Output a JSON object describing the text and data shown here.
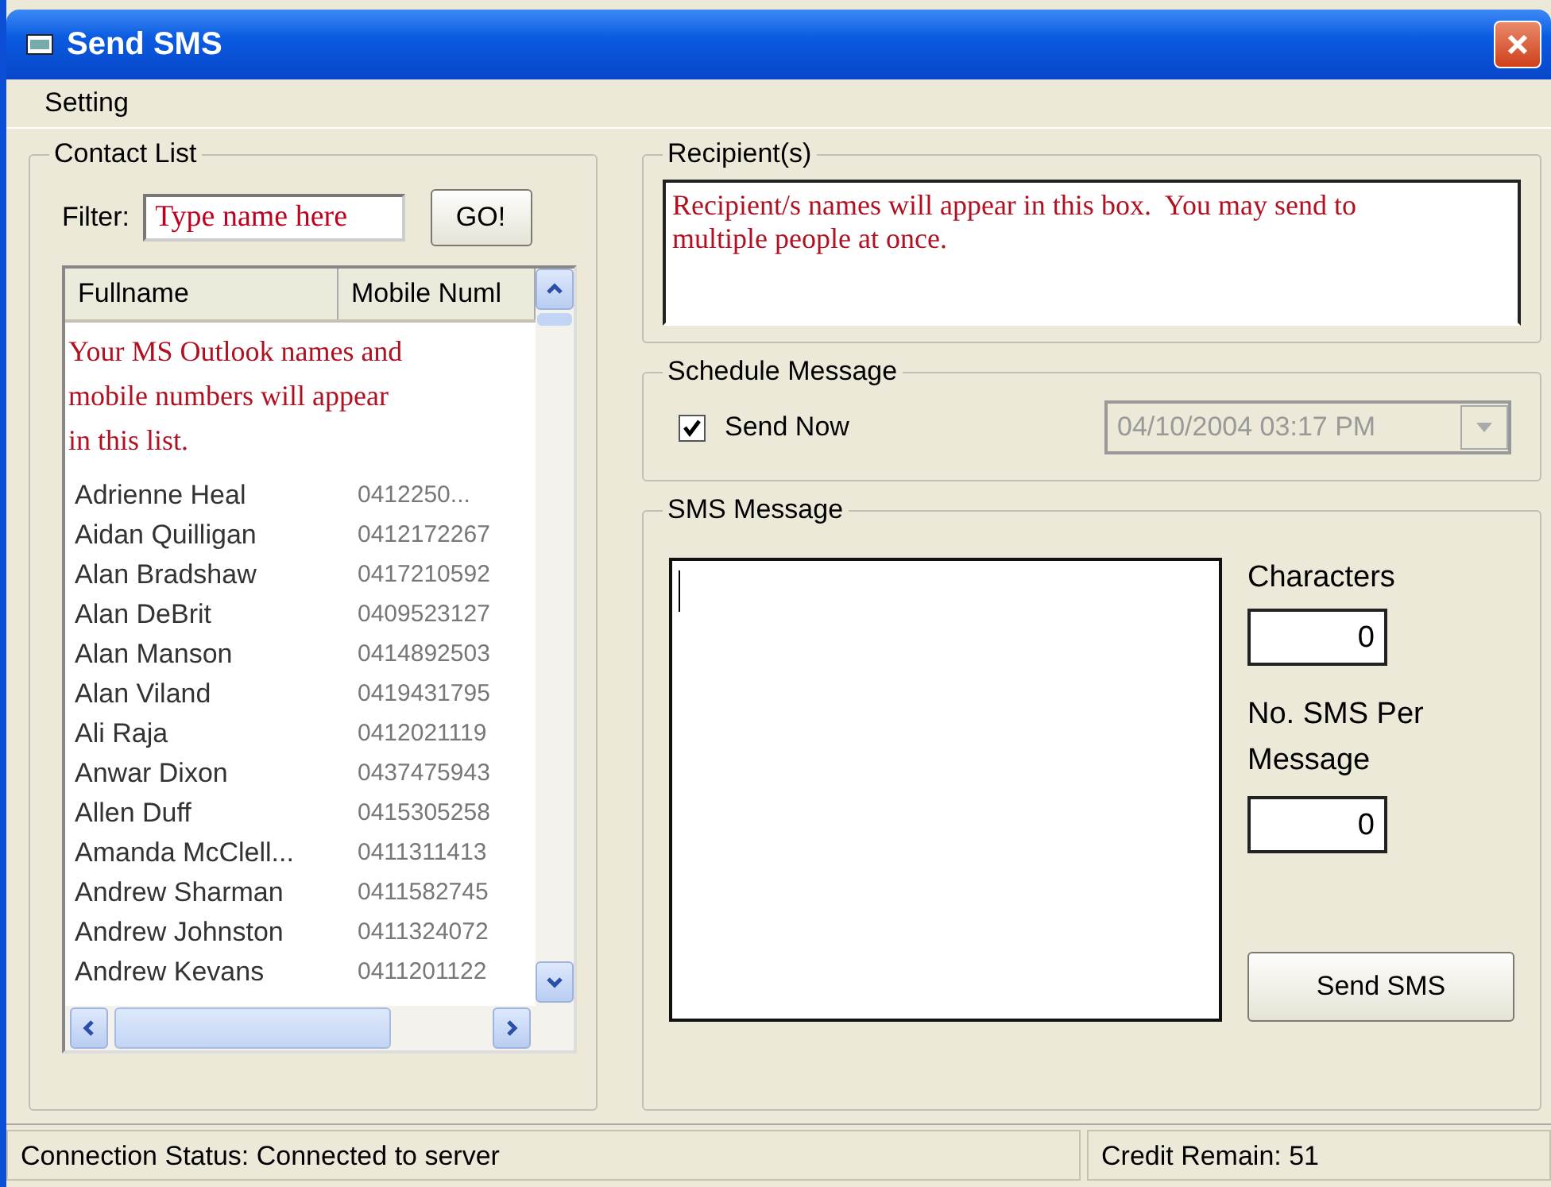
{
  "window": {
    "title": "Send SMS"
  },
  "menu": [
    "Setting"
  ],
  "contact_list": {
    "title": "Contact List",
    "filter_label": "Filter:",
    "filter_placeholder": "Type name here",
    "go_button": "GO!",
    "columns": [
      "Fullname",
      "Mobile Numl"
    ],
    "overlay_text": "Your MS Outlook names and mobile numbers will appear in this list.",
    "rows": [
      {
        "name": "Adrienne Heal",
        "mobile": "0412250..."
      },
      {
        "name": "Aidan Quilligan",
        "mobile": "0412172267"
      },
      {
        "name": "Alan Bradshaw",
        "mobile": "0417210592"
      },
      {
        "name": "Alan DeBrit",
        "mobile": "0409523127"
      },
      {
        "name": "Alan Manson",
        "mobile": "0414892503"
      },
      {
        "name": "Alan Viland",
        "mobile": "0419431795"
      },
      {
        "name": "Ali Raja",
        "mobile": "0412021119"
      },
      {
        "name": "Anwar Dixon",
        "mobile": "0437475943"
      },
      {
        "name": "Allen Duff",
        "mobile": "0415305258"
      },
      {
        "name": "Amanda McClell...",
        "mobile": "0411311413"
      },
      {
        "name": "Andrew Sharman",
        "mobile": "0411582745"
      },
      {
        "name": "Andrew Johnston",
        "mobile": "0411324072"
      },
      {
        "name": "Andrew Kevans",
        "mobile": "0411201122"
      }
    ]
  },
  "recipients": {
    "title": "Recipient(s)",
    "placeholder": "Recipient/s names will appear in this box.  You may send to multiple people at once."
  },
  "schedule": {
    "title": "Schedule Message",
    "send_now": {
      "label": "Send Now",
      "checked": true
    },
    "datetime": {
      "value": "04/10/2004 03:17 PM",
      "disabled": true
    }
  },
  "sms": {
    "title": "SMS Message",
    "characters_label": "Characters",
    "characters": "0",
    "per_message_label": "No. SMS Per Message",
    "per_message": "0",
    "send_button": "Send SMS"
  },
  "status_bar": {
    "connection": "Connection Status: Connected to server",
    "credit": "Credit Remain: 51"
  }
}
